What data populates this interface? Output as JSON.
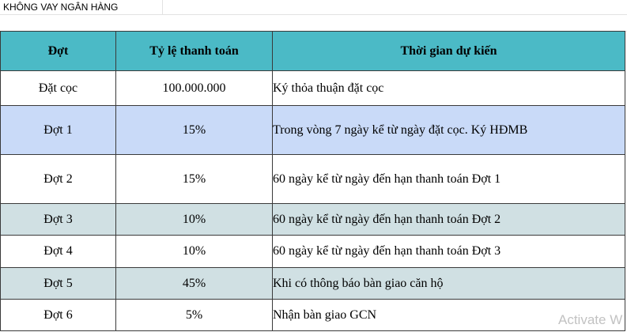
{
  "sheet": {
    "title": "KHÔNG VAY NGÂN HÀNG"
  },
  "table": {
    "headers": [
      "Đợt",
      "Tỷ lệ thanh toán",
      "Thời gian dự kiến"
    ],
    "rows": [
      {
        "installment": "Đặt cọc",
        "rate": "100.000.000",
        "schedule": "Ký thỏa thuận đặt cọc"
      },
      {
        "installment": "Đợt 1",
        "rate": "15%",
        "schedule": "Trong vòng 7 ngày kể từ ngày đặt cọc. Ký HĐMB"
      },
      {
        "installment": "Đợt 2",
        "rate": "15%",
        "schedule": "60 ngày kể từ ngày đến hạn thanh toán Đợt 1"
      },
      {
        "installment": "Đợt 3",
        "rate": "10%",
        "schedule": "60 ngày kể từ ngày đến hạn thanh toán Đợt 2"
      },
      {
        "installment": "Đợt 4",
        "rate": "10%",
        "schedule": "60 ngày kể từ ngày đến hạn thanh toán Đợt 3"
      },
      {
        "installment": "Đợt 5",
        "rate": "45%",
        "schedule": "Khi có thông báo bàn giao căn hộ"
      },
      {
        "installment": "Đợt 6",
        "rate": "5%",
        "schedule": "Nhận bàn giao GCN"
      }
    ]
  },
  "colors": {
    "header": "#4bbac6",
    "row_blue": "#c9daf8",
    "row_grey": "#d0e0e3"
  },
  "overlay": {
    "watermark": "Activate W"
  }
}
